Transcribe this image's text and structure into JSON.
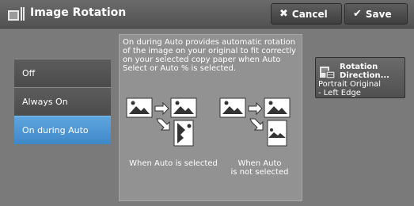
{
  "header": {
    "title": "Image Rotation",
    "cancel_label": "Cancel",
    "save_label": "Save"
  },
  "options": [
    {
      "label": "Off",
      "selected": false
    },
    {
      "label": "Always On",
      "selected": false
    },
    {
      "label": "On during Auto",
      "selected": true
    }
  ],
  "info": {
    "description": "On during Auto provides automatic rotation of the image on your original to fit correctly on your selected copy paper when Auto Select or Auto % is selected.",
    "caption_auto": "When Auto is selected",
    "caption_not_auto_line1": "When Auto",
    "caption_not_auto_line2": "is not selected"
  },
  "rotation_direction": {
    "label_line1": "Rotation",
    "label_line2": "Direction...",
    "value_line1": "Portrait Original",
    "value_line2": "- Left Edge"
  },
  "colors": {
    "selected": "#4a92d1",
    "panel": "#929292",
    "background": "#7a7a7a"
  }
}
